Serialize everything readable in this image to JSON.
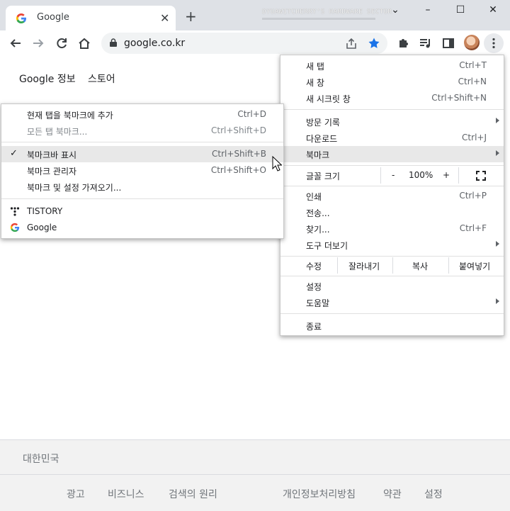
{
  "tab": {
    "title": "Google",
    "close": "✕",
    "new_tab": "+"
  },
  "watermark": "DYUAWITCHERRY'S HARDWARE SECTOR",
  "window": {
    "minimize": "–",
    "maximize": "☐",
    "close": "✕",
    "tab_search": "⌄"
  },
  "omnibox": {
    "url": "google.co.kr"
  },
  "page": {
    "links": [
      "Google 정보",
      "스토어"
    ],
    "footer_country": "대한민국",
    "footer_links": [
      "광고",
      "비즈니스",
      "검색의 원리",
      "개인정보처리방침",
      "약관",
      "설정"
    ]
  },
  "chrome_menu": {
    "new_tab": {
      "label": "새 탭",
      "shortcut": "Ctrl+T"
    },
    "new_window": {
      "label": "새 창",
      "shortcut": "Ctrl+N"
    },
    "incognito": {
      "label": "새 시크릿 창",
      "shortcut": "Ctrl+Shift+N"
    },
    "history": {
      "label": "방문 기록"
    },
    "downloads": {
      "label": "다운로드",
      "shortcut": "Ctrl+J"
    },
    "bookmarks": {
      "label": "북마크"
    },
    "zoom": {
      "label": "글꼴 크기",
      "minus": "-",
      "value": "100%",
      "plus": "+"
    },
    "print": {
      "label": "인쇄",
      "shortcut": "Ctrl+P"
    },
    "cast": {
      "label": "전송..."
    },
    "find": {
      "label": "찾기...",
      "shortcut": "Ctrl+F"
    },
    "more_tools": {
      "label": "도구 더보기"
    },
    "edit": {
      "label": "수정",
      "cut": "잘라내기",
      "copy": "복사",
      "paste": "붙여넣기"
    },
    "settings": {
      "label": "설정"
    },
    "help": {
      "label": "도움말"
    },
    "exit": {
      "label": "종료"
    }
  },
  "bookmark_menu": {
    "add_bookmark": {
      "label": "현재 탭을 북마크에 추가",
      "shortcut": "Ctrl+D"
    },
    "bookmark_all": {
      "label": "모든 탭 북마크...",
      "shortcut": "Ctrl+Shift+D"
    },
    "show_bar": {
      "label": "북마크바 표시",
      "shortcut": "Ctrl+Shift+B",
      "check": "✓"
    },
    "manager": {
      "label": "북마크 관리자",
      "shortcut": "Ctrl+Shift+O"
    },
    "import": {
      "label": "북마크 및 설정 가져오기..."
    },
    "bookmarks": [
      {
        "label": "TISTORY",
        "icon": "tistory-icon"
      },
      {
        "label": "Google",
        "icon": "google-icon"
      }
    ]
  },
  "colors": {
    "tabstrip": "#dee1e6",
    "star": "#1a73e8",
    "menu_highlight": "#e8e8e8"
  }
}
